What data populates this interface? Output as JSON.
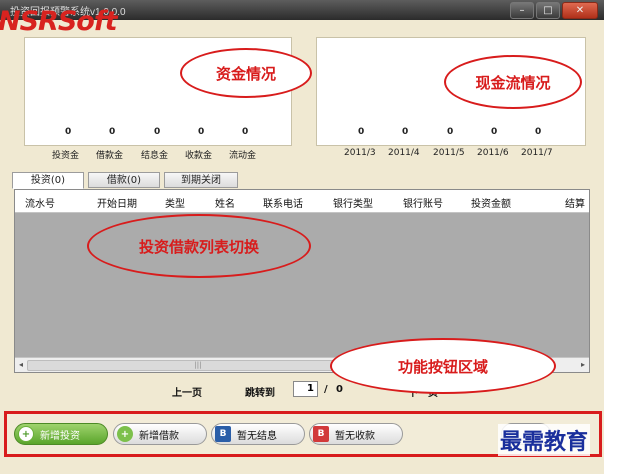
{
  "window": {
    "title": "投资回报预警系统v1.0.0.0",
    "controls": [
      "minimize",
      "maximize",
      "close"
    ]
  },
  "logo": {
    "text": "NSRSoft"
  },
  "funds_panel": {
    "callout": "资金情况",
    "bars": [
      {
        "label": "投资金",
        "value": "0"
      },
      {
        "label": "借款金",
        "value": "0"
      },
      {
        "label": "结息金",
        "value": "0"
      },
      {
        "label": "收款金",
        "value": "0"
      },
      {
        "label": "流动金",
        "value": "0"
      }
    ]
  },
  "cashflow_panel": {
    "callout": "现金流情况",
    "bars": [
      {
        "label": "2011/3",
        "value": "0"
      },
      {
        "label": "2011/4",
        "value": "0"
      },
      {
        "label": "2011/5",
        "value": "0"
      },
      {
        "label": "2011/6",
        "value": "0"
      },
      {
        "label": "2011/7",
        "value": "0"
      }
    ]
  },
  "tabs": [
    {
      "label": "投资(0)",
      "active": true
    },
    {
      "label": "借款(0)",
      "active": false
    },
    {
      "label": "到期关闭",
      "active": false
    }
  ],
  "grid": {
    "callout": "投资借款列表切换",
    "columns": [
      "流水号",
      "开始日期",
      "类型",
      "姓名",
      "联系电话",
      "银行类型",
      "银行账号",
      "投资金额",
      "结算"
    ]
  },
  "pager": {
    "prev": "上一页",
    "jump": "跳转到",
    "page": "1",
    "separator": "/",
    "total": "0",
    "next": "下一页"
  },
  "actions": {
    "callout": "功能按钮区域",
    "buttons": [
      {
        "label": "新增投资"
      },
      {
        "label": "新增借款"
      },
      {
        "label": "暂无结息"
      },
      {
        "label": "暂无收款"
      }
    ]
  },
  "watermark": "最需教育",
  "colors": {
    "accent_red": "#d81c1c",
    "background": "#f0e9d2",
    "watermark": "#1a2f9c"
  }
}
